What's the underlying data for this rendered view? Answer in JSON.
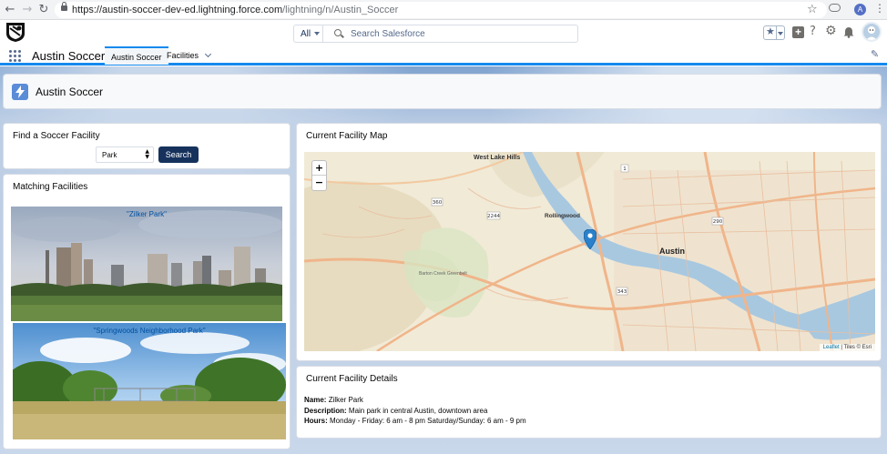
{
  "browser": {
    "url_domain": "https://austin-soccer-dev-ed.lightning.force.com",
    "url_path": "/lightning/n/Austin_Soccer",
    "profile_initial": "A"
  },
  "header": {
    "search_scope": "All",
    "search_placeholder": "Search Salesforce"
  },
  "app_nav": {
    "app_name": "Austin Soccer",
    "tabs": [
      {
        "label": "Austin Soccer",
        "active": true
      },
      {
        "label": "Facilities",
        "active": false
      }
    ]
  },
  "page_header": {
    "title": "Austin Soccer"
  },
  "find": {
    "title": "Find a Soccer Facility",
    "select_value": "Park",
    "button_label": "Search"
  },
  "matching": {
    "title": "Matching Facilities",
    "items": [
      {
        "caption": "\"Zilker Park\""
      },
      {
        "caption": "\"Springwoods Neighborhood Park\""
      }
    ]
  },
  "map": {
    "title": "Current Facility Map",
    "labels": [
      "West Lake Hills",
      "Rollingwood",
      "Austin",
      "Barton Creek Greenbelt"
    ],
    "road_shields": [
      "1",
      "360",
      "2244",
      "290",
      "343"
    ],
    "attribution_link": "Leaflet",
    "attribution_text": "| Tiles © Esri"
  },
  "details": {
    "title": "Current Facility Details",
    "name_label": "Name:",
    "name_value": "Zilker Park",
    "description_label": "Description:",
    "description_value": "Main park in central Austin, downtown area",
    "hours_label": "Hours:",
    "hours_value": "Monday - Friday: 6 am - 8 pm Saturday/Sunday: 6 am - 9 pm"
  },
  "colors": {
    "accent": "#1589ee",
    "button": "#16325c",
    "map_water": "#a8c8e0",
    "map_road": "#f0b58a",
    "marker": "#2a81cb"
  }
}
